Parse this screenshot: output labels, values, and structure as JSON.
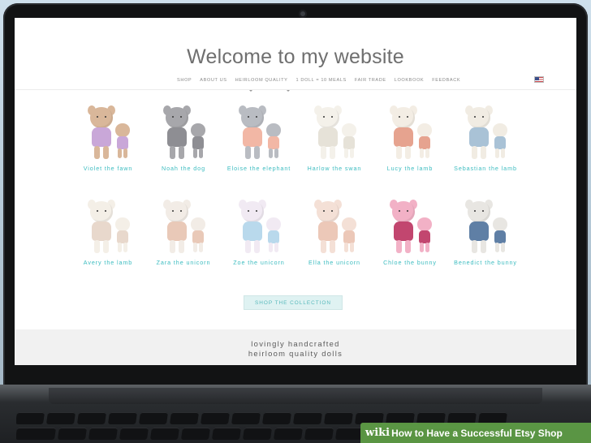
{
  "site": {
    "title": "Welcome to my website",
    "nav": [
      "SHOP",
      "ABOUT US",
      "HEIRLOOM QUALITY",
      "1 DOLL = 10 MEALS",
      "FAIR TRADE",
      "LOOKBOOK",
      "FEEDBACK"
    ],
    "flag_icon": "us-flag-icon"
  },
  "products": [
    {
      "name": "Violet the fawn",
      "colors": [
        "#d9b79a",
        "#c9a7d8"
      ]
    },
    {
      "name": "Noah the dog",
      "colors": [
        "#a7a7ab",
        "#8e8e93"
      ]
    },
    {
      "name": "Eloise the elephant",
      "colors": [
        "#b9bcc2",
        "#f2b7a5"
      ]
    },
    {
      "name": "Harlow the swan",
      "colors": [
        "#f4f1ea",
        "#e6e2d8"
      ]
    },
    {
      "name": "Lucy the lamb",
      "colors": [
        "#f3ede4",
        "#e6a38f"
      ]
    },
    {
      "name": "Sebastian the lamb",
      "colors": [
        "#f1ece3",
        "#a9c2d6"
      ]
    },
    {
      "name": "Avery the lamb",
      "colors": [
        "#f4efe7",
        "#e8d8cc"
      ]
    },
    {
      "name": "Zara the unicorn",
      "colors": [
        "#f2ece6",
        "#e9c9b8"
      ]
    },
    {
      "name": "Zoe the unicorn",
      "colors": [
        "#f1eaf3",
        "#b9d9ec"
      ]
    },
    {
      "name": "Ella the unicorn",
      "colors": [
        "#f4e0d6",
        "#ecc8b8"
      ]
    },
    {
      "name": "Chloe the bunny",
      "colors": [
        "#f2b1c6",
        "#c2466f"
      ]
    },
    {
      "name": "Benedict the bunny",
      "colors": [
        "#e8e6e2",
        "#5f7fa5"
      ]
    }
  ],
  "cta_label": "SHOP THE COLLECTION",
  "tagline": [
    "lovingly handcrafted",
    "heirloom quality dolls"
  ],
  "banner": {
    "logo": "wiki",
    "text": "How to Have a Successful Etsy Shop"
  }
}
